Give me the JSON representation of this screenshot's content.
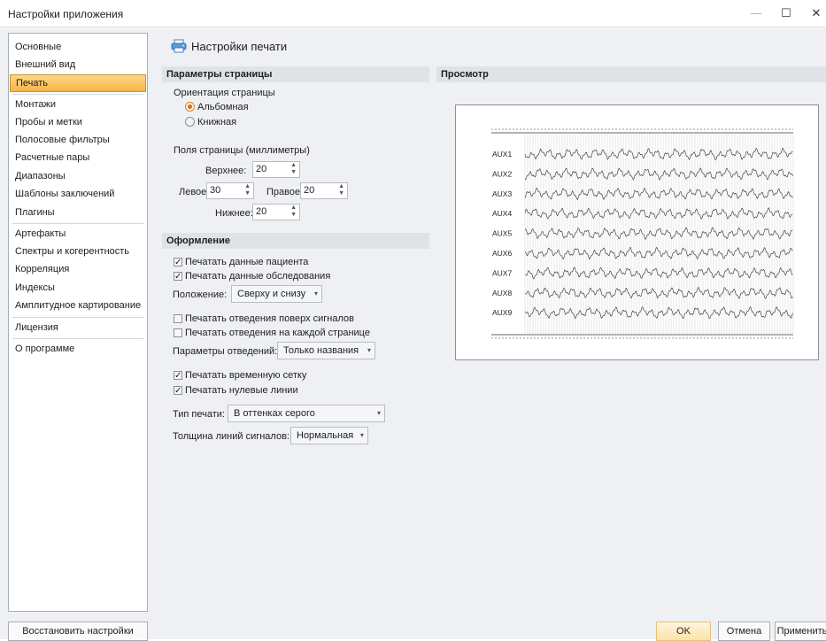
{
  "window": {
    "title": "Настройки приложения",
    "minimize": "—",
    "maximize": "☐",
    "close": "✕"
  },
  "sidebar": {
    "items": [
      {
        "label": "Основные"
      },
      {
        "label": "Внешний вид"
      },
      {
        "label": "Печать",
        "active": true
      },
      {
        "label": "Монтажи"
      },
      {
        "label": "Пробы и метки"
      },
      {
        "label": "Полосовые фильтры"
      },
      {
        "label": "Расчетные пары"
      },
      {
        "label": "Диапазоны"
      },
      {
        "label": "Шаблоны заключений"
      },
      {
        "label": "Плагины"
      },
      {
        "label": "Артефакты"
      },
      {
        "label": "Спектры и когерентность"
      },
      {
        "label": "Корреляция"
      },
      {
        "label": "Индексы"
      },
      {
        "label": "Амплитудное картирование"
      },
      {
        "label": "Лицензия"
      },
      {
        "label": "О программе"
      }
    ],
    "reset_button": "Восстановить настройки"
  },
  "page": {
    "title": "Настройки печати",
    "icon": "printer-icon"
  },
  "page_params": {
    "section_title": "Параметры страницы",
    "orientation_label": "Ориентация страницы",
    "orientation_options": [
      "Альбомная",
      "Книжная"
    ],
    "orientation_selected": "Альбомная",
    "margins_label": "Поля страницы (миллиметры)",
    "top_label": "Верхнее:",
    "top_value": "20",
    "left_label": "Левое:",
    "left_value": "30",
    "right_label": "Правое:",
    "right_value": "20",
    "bottom_label": "Нижнее:",
    "bottom_value": "20"
  },
  "appearance": {
    "section_title": "Оформление",
    "print_patient": {
      "label": "Печатать данные пациента",
      "checked": true
    },
    "print_exam": {
      "label": "Печатать данные обследования",
      "checked": true
    },
    "position_label": "Положение:",
    "position_value": "Сверху и снизу",
    "leads_over": {
      "label": "Печатать отведения поверх сигналов",
      "checked": false
    },
    "leads_each": {
      "label": "Печатать отведения на каждой странице",
      "checked": false
    },
    "lead_params_label": "Параметры отведений:",
    "lead_params_value": "Только названия",
    "time_grid": {
      "label": "Печатать временную сетку",
      "checked": true
    },
    "zero_lines": {
      "label": "Печатать нулевые линии",
      "checked": true
    },
    "print_type_label": "Тип печати:",
    "print_type_value": "В оттенках серого",
    "line_thickness_label": "Толщина линий сигналов:",
    "line_thickness_value": "Нормальная"
  },
  "preview": {
    "section_title": "Просмотр",
    "channels": [
      "AUX1",
      "AUX2",
      "AUX3",
      "AUX4",
      "AUX5",
      "AUX6",
      "AUX7",
      "AUX8",
      "AUX9"
    ]
  },
  "footer": {
    "ok": "OK",
    "cancel": "Отмена",
    "apply": "Применить"
  },
  "colors": {
    "accent": "#f8b446",
    "section_bg": "#dfe2e7",
    "window_bg": "#eef0f3"
  }
}
